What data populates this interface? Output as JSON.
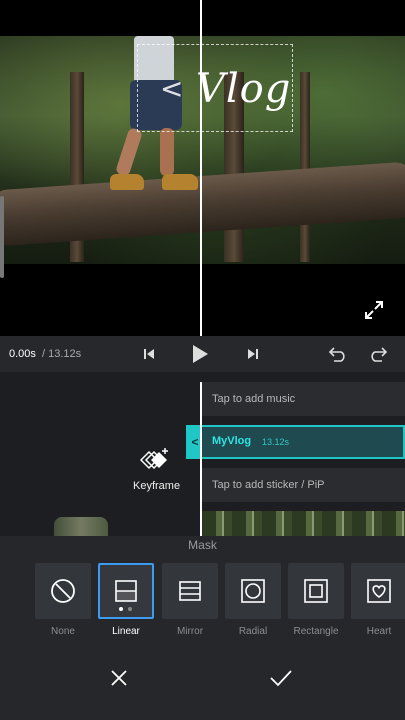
{
  "preview": {
    "overlay_title": "Vlog",
    "overlay_chevron": "<"
  },
  "playback": {
    "current_time": "0.00s",
    "total_time": "/ 13.12s"
  },
  "timeline": {
    "keyframe_label": "Keyframe",
    "music_track": "Tap to add music",
    "clip_name": "MyVlog",
    "clip_duration": "13.12s",
    "sticker_track": "Tap to add sticker / PiP",
    "clip_handle": "<"
  },
  "mask": {
    "title": "Mask",
    "options": [
      {
        "label": "None",
        "icon": "none-icon"
      },
      {
        "label": "Linear",
        "icon": "linear-icon"
      },
      {
        "label": "Mirror",
        "icon": "mirror-icon"
      },
      {
        "label": "Radial",
        "icon": "radial-icon"
      },
      {
        "label": "Rectangle",
        "icon": "rectangle-icon"
      },
      {
        "label": "Heart",
        "icon": "heart-icon"
      }
    ],
    "selected": "Linear"
  },
  "colors": {
    "accent_teal": "#21c7c7",
    "selection_blue": "#3d9bf0",
    "panel_bg": "#25272b"
  }
}
